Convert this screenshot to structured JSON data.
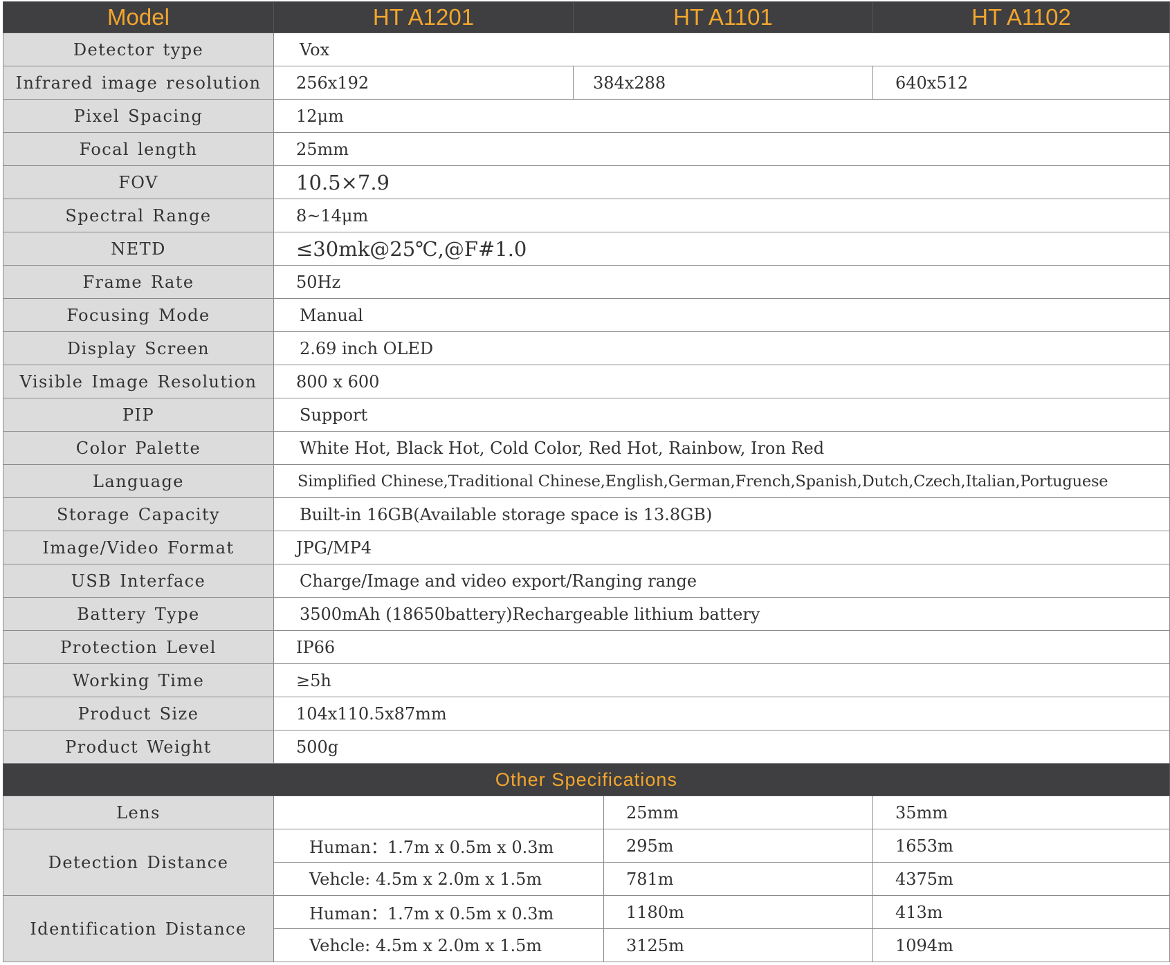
{
  "header": {
    "model_label": "Model",
    "models": [
      "HT A1201",
      "HT A1101",
      "HT A1102"
    ]
  },
  "specs": [
    {
      "label": "Detector type",
      "value": "Vox"
    },
    {
      "label": "Infrared image resolution",
      "values": [
        "256x192",
        "384x288",
        "640x512"
      ]
    },
    {
      "label": "Pixel Spacing",
      "value": "12μm"
    },
    {
      "label": "Focal length",
      "value": "25mm"
    },
    {
      "label": "FOV",
      "value": "10.5×7.9"
    },
    {
      "label": "Spectral Range",
      "value": "8~14μm"
    },
    {
      "label": "NETD",
      "value": "≤30mk@25℃,@F#1.0"
    },
    {
      "label": "Frame Rate",
      "value": "50Hz"
    },
    {
      "label": "Focusing Mode",
      "value": "Manual"
    },
    {
      "label": "Display Screen",
      "value": "2.69 inch OLED"
    },
    {
      "label": "Visible Image Resolution",
      "value": "800 x 600"
    },
    {
      "label": "PIP",
      "value": "Support"
    },
    {
      "label": "Color Palette",
      "value": "White Hot, Black Hot, Cold Color, Red Hot, Rainbow, Iron Red"
    },
    {
      "label": "Language",
      "value": "Simplified Chinese,Traditional Chinese,English,German,French,Spanish,Dutch,Czech,Italian,Portuguese"
    },
    {
      "label": "Storage Capacity",
      "value": "Built-in 16GB(Available storage space is 13.8GB)"
    },
    {
      "label": "Image/Video Format",
      "value": "JPG/MP4"
    },
    {
      "label": "USB Interface",
      "value": "Charge/Image and video export/Ranging range"
    },
    {
      "label": "Battery Type",
      "value": "3500mAh (18650battery)Rechargeable lithium battery"
    },
    {
      "label": "Protection Level",
      "value": "IP66"
    },
    {
      "label": "Working Time",
      "value": "≥5h"
    },
    {
      "label": "Product Size",
      "value": "104x110.5x87mm"
    },
    {
      "label": "Product Weight",
      "value": "500g"
    }
  ],
  "other": {
    "title": "Other Specifications",
    "lens": {
      "label": "Lens",
      "values": [
        "",
        "25mm",
        "35mm"
      ]
    },
    "detection": {
      "label": "Detection Distance",
      "rows": [
        {
          "target": "Human：1.7m x 0.5m x 0.3m",
          "values": [
            "295m",
            "1653m"
          ]
        },
        {
          "target": "Vehcle: 4.5m x 2.0m x 1.5m",
          "values": [
            "781m",
            "4375m"
          ]
        }
      ]
    },
    "identification": {
      "label": "Identification Distance",
      "rows": [
        {
          "target": "Human：1.7m x 0.5m x 0.3m",
          "values": [
            "1180m",
            "413m"
          ]
        },
        {
          "target": "Vehcle: 4.5m x 2.0m x 1.5m",
          "values": [
            "3125m",
            "1094m"
          ]
        }
      ]
    }
  }
}
